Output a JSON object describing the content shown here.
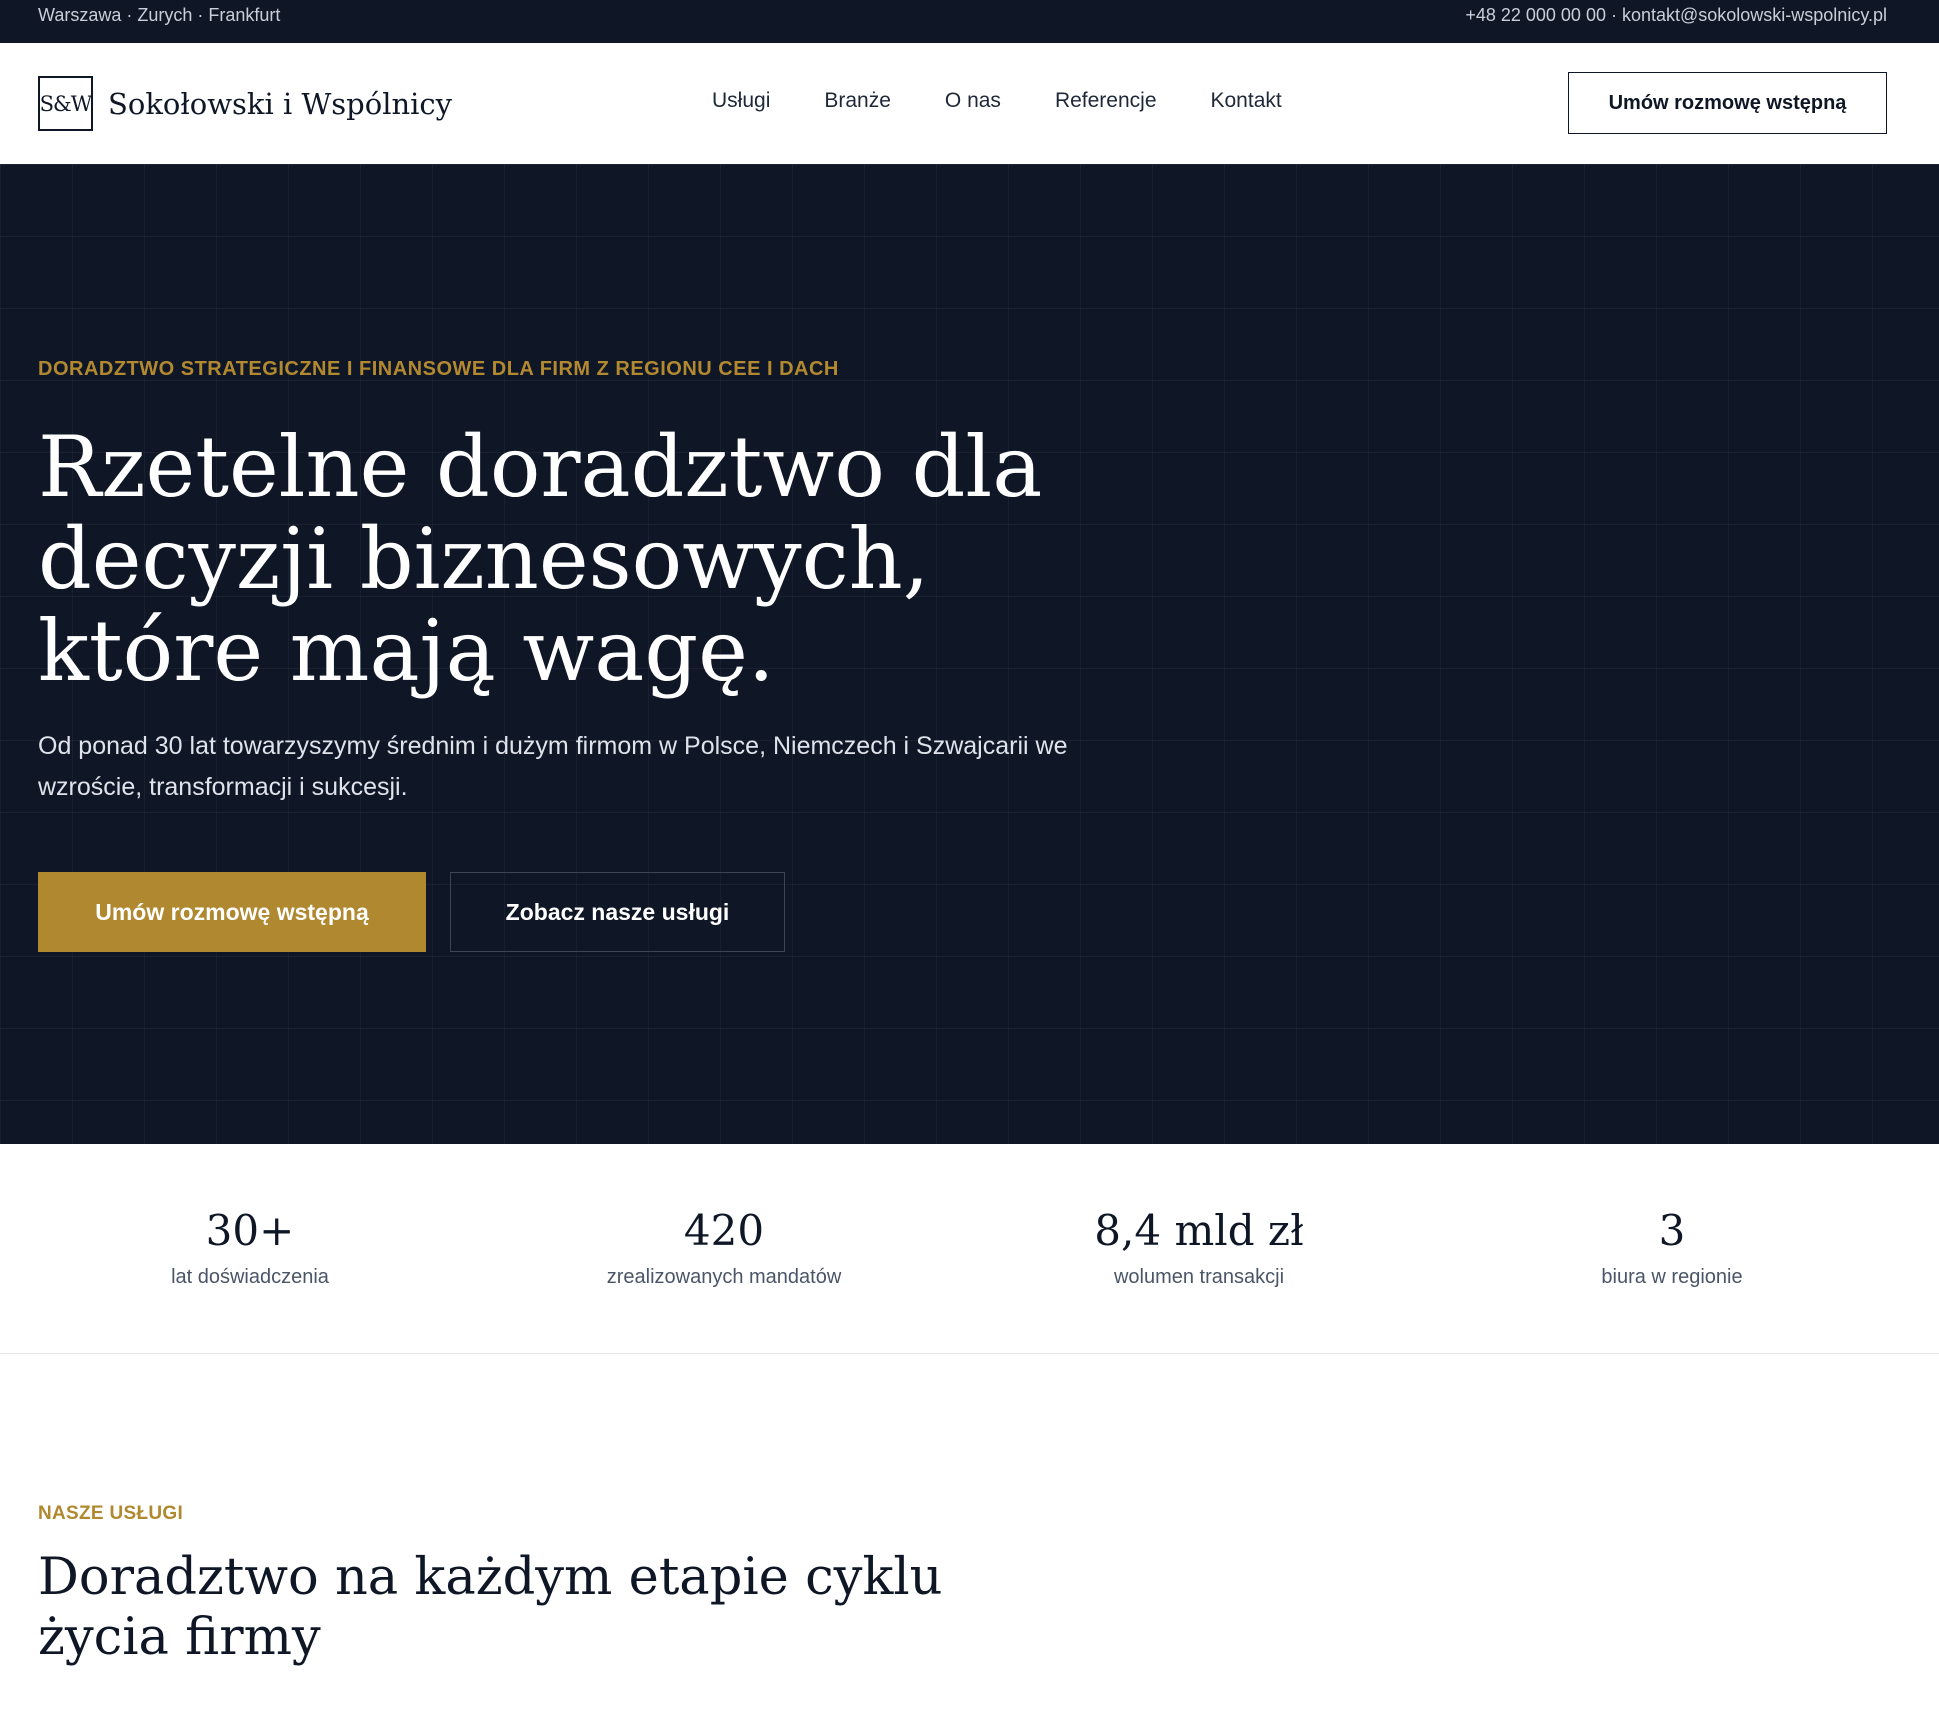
{
  "topbar": {
    "locations": "Warszawa · Zurych · Frankfurt",
    "contact": "+48 22 000 00 00 · kontakt@sokolowski-wspolnicy.pl"
  },
  "header": {
    "logo_mark": "S&W",
    "brand_name": "Sokołowski i Wspólnicy",
    "nav": [
      "Usługi",
      "Branże",
      "O nas",
      "Referencje",
      "Kontakt"
    ],
    "cta": "Umów rozmowę wstępną"
  },
  "hero": {
    "eyebrow": "DORADZTWO STRATEGICZNE I FINANSOWE DLA FIRM Z REGIONU CEE I DACH",
    "title_lines": [
      "Rzetelne doradztwo dla",
      "decyzji biznesowych,",
      "które mają wagę."
    ],
    "subtitle": "Od ponad 30 lat towarzyszymy średnim i dużym firmom w Polsce, Niemczech i Szwajcarii we wzroście, transformacji i sukcesji.",
    "primary_button": "Umów rozmowę wstępną",
    "secondary_button": "Zobacz nasze usługi"
  },
  "stats": [
    {
      "value": "30+",
      "label": "lat doświadczenia"
    },
    {
      "value": "420",
      "label": "zrealizowanych mandatów"
    },
    {
      "value": "8,4 mld zł",
      "label": "wolumen transakcji"
    },
    {
      "value": "3",
      "label": "biura w regionie"
    }
  ],
  "services": {
    "eyebrow": "NASZE USŁUGI",
    "title_lines": [
      "Doradztwo na każdym etapie cyklu",
      "życia firmy"
    ]
  },
  "colors": {
    "navy": "#0f1727",
    "gold": "#b08830"
  }
}
